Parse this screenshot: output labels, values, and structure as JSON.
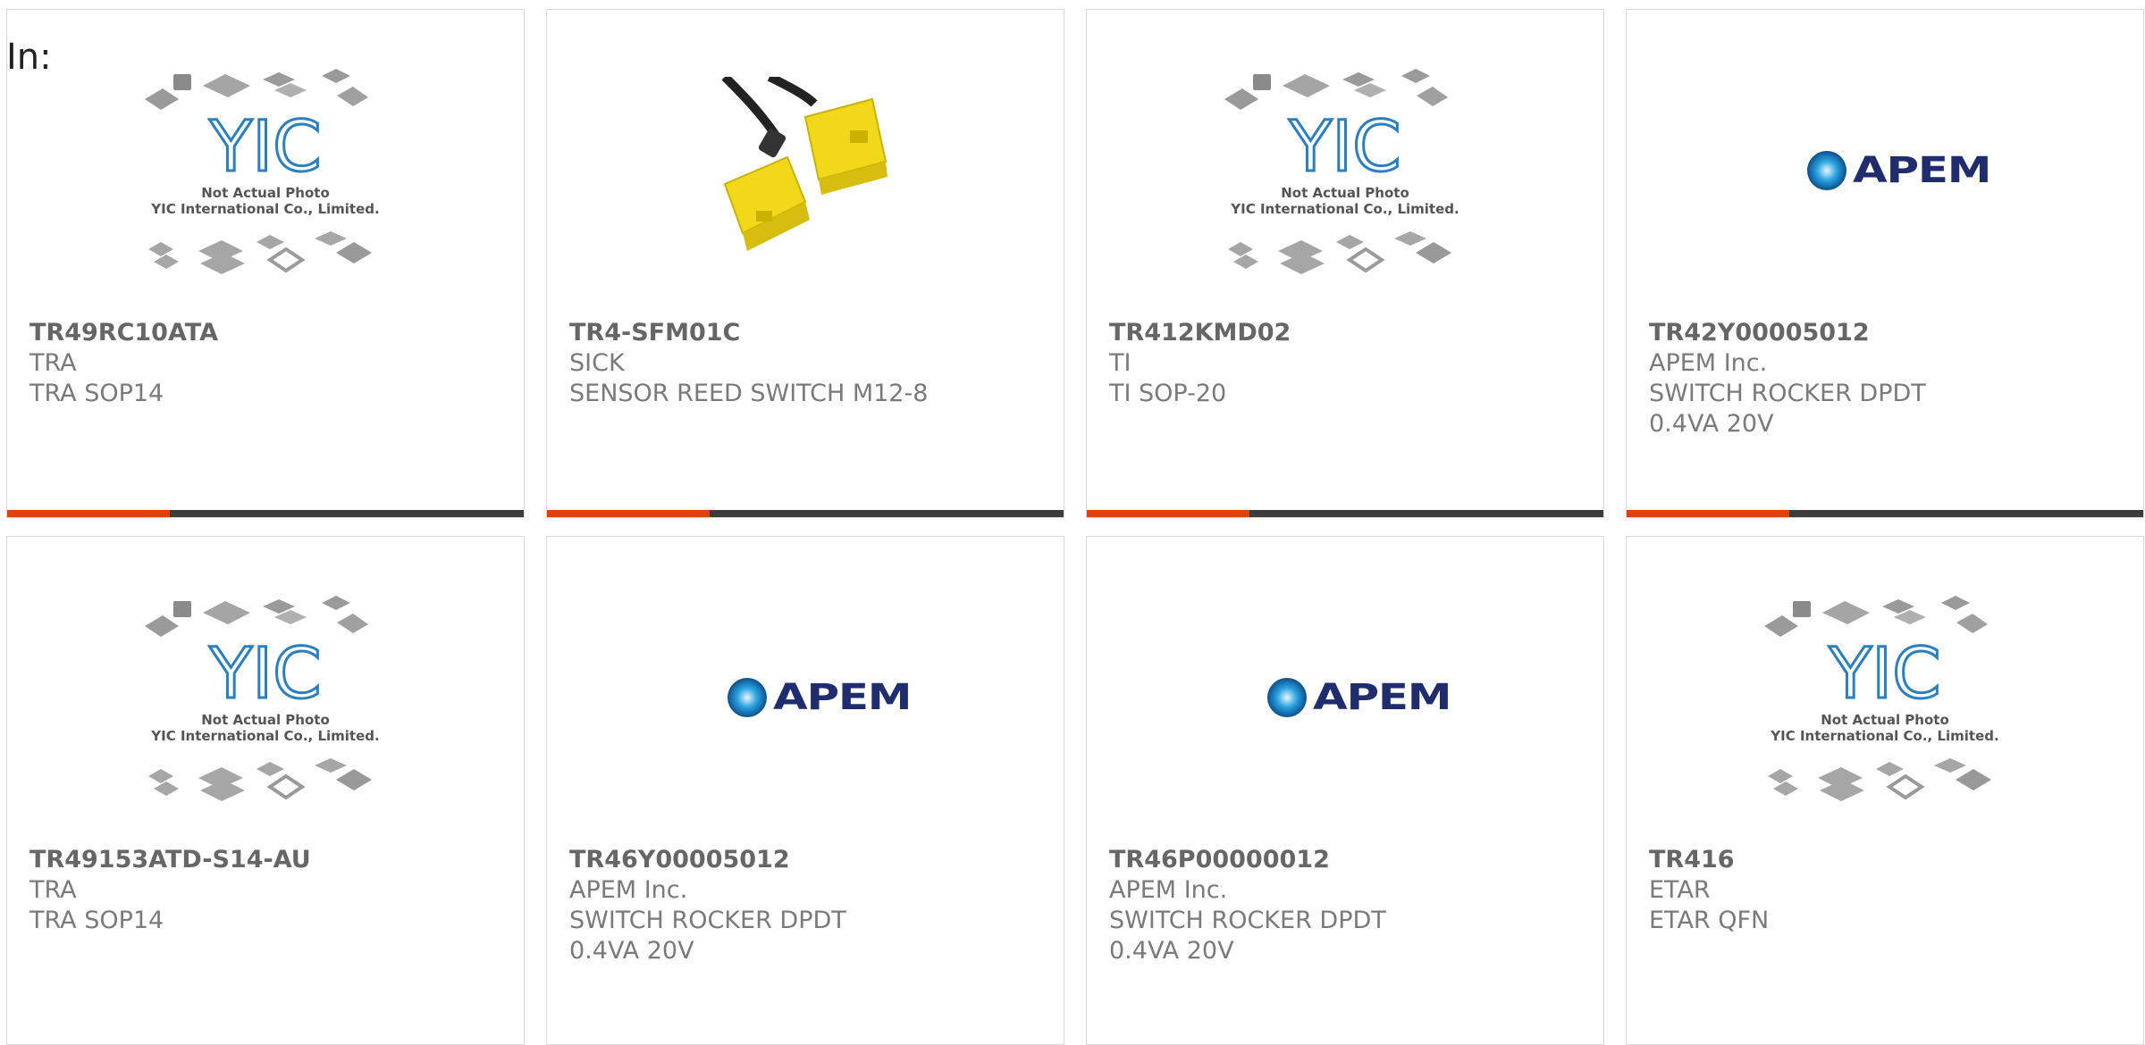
{
  "header": {
    "in_label": "In:"
  },
  "colors": {
    "accent": "#e0400f",
    "bar": "#3b3b3b",
    "apem_blue": "#1f2d6e",
    "yic_blue": "#2a7fc1"
  },
  "placeholder": {
    "line1": "Not Actual Photo",
    "line2": "YIC International Co., Limited.",
    "logo_text": "YIC"
  },
  "products": [
    {
      "part_number": "TR49RC10ATA",
      "manufacturer": "TRA",
      "description": "TRA SOP14",
      "image": "yic-placeholder"
    },
    {
      "part_number": "TR4-SFM01C",
      "manufacturer": "SICK",
      "description": "SENSOR REED SWITCH M12-8",
      "image": "reed-switch-photo"
    },
    {
      "part_number": "TR412KMD02",
      "manufacturer": "TI",
      "description": "TI SOP-20",
      "image": "yic-placeholder"
    },
    {
      "part_number": "TR42Y00005012",
      "manufacturer": "APEM Inc.",
      "description": "SWITCH ROCKER DPDT 0.4VA 20V",
      "image": "apem-logo",
      "logo_text": "APEM"
    },
    {
      "part_number": "TR49153ATD-S14-AU",
      "manufacturer": "TRA",
      "description": "TRA SOP14",
      "image": "yic-placeholder"
    },
    {
      "part_number": "TR46Y00005012",
      "manufacturer": "APEM Inc.",
      "description": "SWITCH ROCKER DPDT 0.4VA 20V",
      "image": "apem-logo",
      "logo_text": "APEM"
    },
    {
      "part_number": "TR46P00000012",
      "manufacturer": "APEM Inc.",
      "description": "SWITCH ROCKER DPDT 0.4VA 20V",
      "image": "apem-logo",
      "logo_text": "APEM"
    },
    {
      "part_number": "TR416",
      "manufacturer": "ETAR",
      "description": "ETAR QFN",
      "image": "yic-placeholder"
    }
  ]
}
